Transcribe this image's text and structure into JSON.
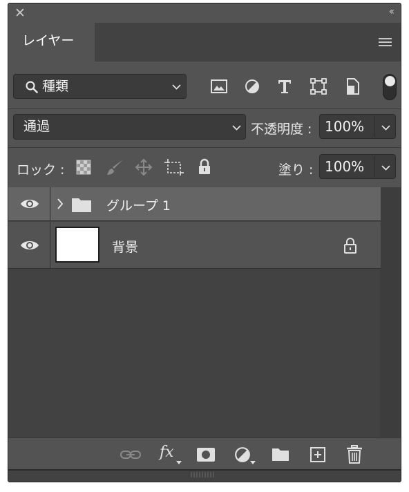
{
  "panel": {
    "close_glyph": "✕",
    "collapse_glyph": "‹‹",
    "tab_label": "レイヤー"
  },
  "filter": {
    "kind_label": "種類"
  },
  "blend": {
    "mode": "通過",
    "opacity_label": "不透明度 :",
    "opacity_value": "100%"
  },
  "lock": {
    "label": "ロック :",
    "fill_label": "塗り :",
    "fill_value": "100%"
  },
  "layers": [
    {
      "name": "グループ 1",
      "type": "group",
      "visible": true,
      "selected": true
    },
    {
      "name": "背景",
      "type": "background",
      "visible": true,
      "locked": true
    }
  ],
  "icons": {
    "filter": [
      "image-filter-icon",
      "adjustment-filter-icon",
      "type-filter-icon",
      "shape-filter-icon",
      "smart-object-filter-icon"
    ],
    "lock": [
      "lock-transparent-pixels-icon",
      "lock-image-pixels-icon",
      "lock-position-icon",
      "lock-artboard-icon",
      "lock-all-icon"
    ],
    "bottom": [
      "link-layers-icon",
      "fx-icon",
      "add-mask-icon",
      "new-adjustment-layer-icon",
      "new-group-icon",
      "new-layer-icon",
      "delete-layer-icon"
    ]
  },
  "bottom": {
    "fx_label": "fx"
  },
  "colors": {
    "panel": "#535353",
    "dark": "#424242",
    "selected_row": "#656565",
    "field": "#3b3b3b"
  }
}
